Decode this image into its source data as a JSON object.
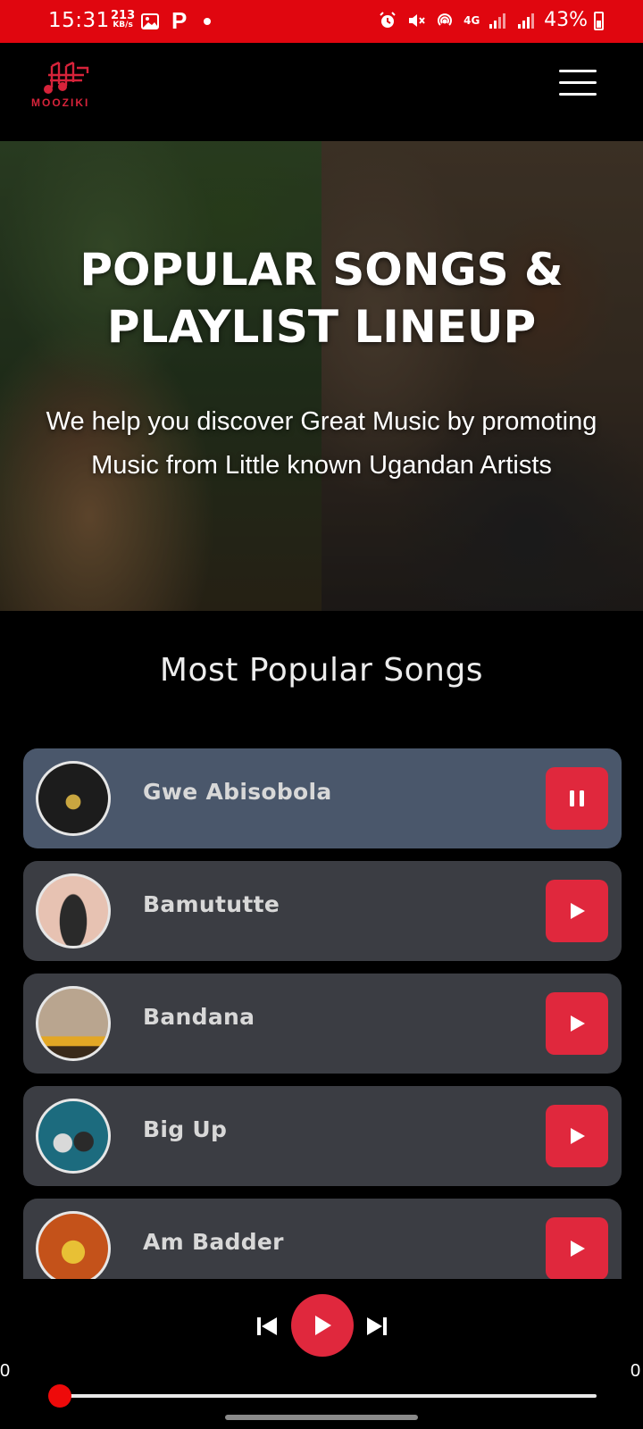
{
  "status_bar": {
    "time": "15:31",
    "net_speed": "213",
    "net_speed_unit": "KB/s",
    "p_badge": "P",
    "battery": "43%",
    "network": "4G"
  },
  "header": {
    "brand": "MOOZIKI",
    "accent": "#d6233a"
  },
  "hero": {
    "title_line1": "POPULAR SONGS &",
    "title_line2": "PLAYLIST LINEUP",
    "subtitle_line1": "We help you discover Great Music by promoting",
    "subtitle_line2": "Music from Little known Ugandan Artists"
  },
  "section": {
    "title": "Most Popular Songs"
  },
  "songs": [
    {
      "name": "Gwe Abisobola",
      "state": "playing",
      "cover_colors": [
        "#1c1c1c",
        "#c9a640"
      ]
    },
    {
      "name": "Bamututte",
      "state": "paused",
      "cover_colors": [
        "#e7c2b2",
        "#2a2a2a"
      ]
    },
    {
      "name": "Bandana",
      "state": "paused",
      "cover_colors": [
        "#b9a58f",
        "#e3a725"
      ]
    },
    {
      "name": "Big Up",
      "state": "paused",
      "cover_colors": [
        "#1c6b7e",
        "#e8e8e8"
      ]
    },
    {
      "name": "Am Badder",
      "state": "paused",
      "cover_colors": [
        "#c4521a",
        "#e8c035"
      ]
    }
  ],
  "player": {
    "elapsed": "0",
    "duration": "0",
    "progress": 0,
    "accent": "#e0283d"
  }
}
